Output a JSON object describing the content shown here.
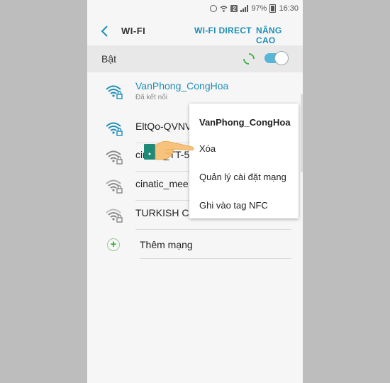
{
  "status_bar": {
    "battery": "97%",
    "time": "16:30",
    "notification_badge": "2"
  },
  "app_bar": {
    "title": "WI-FI",
    "action_wifi_direct": "WI-FI DIRECT",
    "action_advanced": "NÂNG CAO"
  },
  "wifi_toggle": {
    "label": "Bật",
    "state": "on",
    "accent": "#57b5d8"
  },
  "networks": [
    {
      "name": "VanPhong_CongHoa",
      "status": "Đã kết nối",
      "secured": true,
      "connected": true
    },
    {
      "name": "EltQo-QVNV",
      "secured": true
    },
    {
      "name": "cinatic_TT-5",
      "secured": true
    },
    {
      "name": "cinatic_mee",
      "secured": true
    },
    {
      "name": "TURKISH CARGO",
      "secured": true
    }
  ],
  "add_network": {
    "label": "Thêm mạng"
  },
  "context_menu": {
    "title": "VanPhong_CongHoa",
    "items": [
      "Xóa",
      "Quản lý cài đặt mạng",
      "Ghi vào tag NFC"
    ]
  },
  "colors": {
    "accent": "#1e8fb6",
    "background": "#f6f6f6",
    "backdrop": "#bdbdbd"
  }
}
